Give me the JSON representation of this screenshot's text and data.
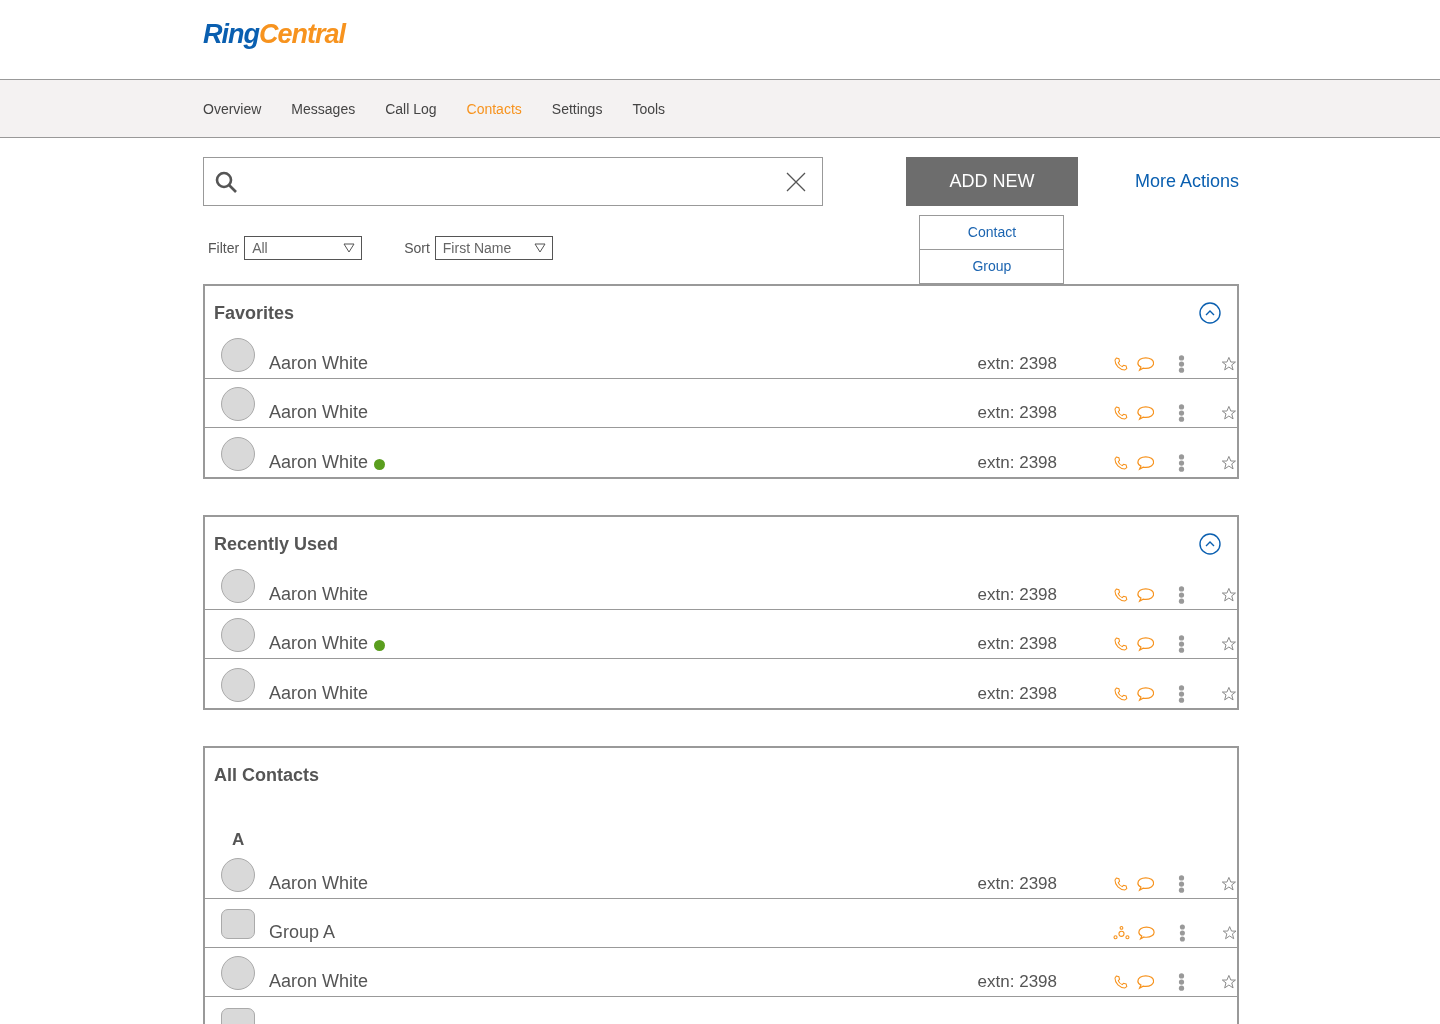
{
  "logo": [
    "Ring",
    "Central"
  ],
  "nav": [
    {
      "label": "Overview",
      "selected": false
    },
    {
      "label": "Messages",
      "selected": false
    },
    {
      "label": "Call Log",
      "selected": false
    },
    {
      "label": "Contacts",
      "selected": true
    },
    {
      "label": "Settings",
      "selected": false
    },
    {
      "label": "Tools",
      "selected": false
    }
  ],
  "add_new": {
    "label": "ADD NEW",
    "menu": [
      "Contact",
      "Group"
    ]
  },
  "more_actions": "More Actions",
  "filter": {
    "label": "Filter",
    "value": "All"
  },
  "sort": {
    "label": "Sort",
    "value": "First Name"
  },
  "sections": [
    {
      "title": "Favorites",
      "expanded": true,
      "rows": [
        {
          "kind": "contact",
          "name": "Aaron White",
          "online": false,
          "extension": "extn: 2398"
        },
        {
          "kind": "contact",
          "name": "Aaron White",
          "online": false,
          "extension": "extn: 2398"
        },
        {
          "kind": "contact",
          "name": "Aaron White",
          "online": true,
          "extension": "extn: 2398"
        }
      ]
    },
    {
      "title": "Recently Used",
      "expanded": true,
      "rows": [
        {
          "kind": "contact",
          "name": "Aaron White",
          "online": false,
          "extension": "extn: 2398"
        },
        {
          "kind": "contact",
          "name": "Aaron White",
          "online": true,
          "extension": "extn: 2398"
        },
        {
          "kind": "contact",
          "name": "Aaron White",
          "online": false,
          "extension": "extn: 2398"
        }
      ]
    },
    {
      "title": "All Contacts",
      "letter": "A",
      "rows": [
        {
          "kind": "contact",
          "name": "Aaron White",
          "online": false,
          "extension": "extn: 2398"
        },
        {
          "kind": "group",
          "name": "Group A",
          "online": false
        },
        {
          "kind": "contact",
          "name": "Aaron White",
          "online": false,
          "extension": "extn: 2398"
        },
        {
          "kind": "group"
        }
      ]
    }
  ]
}
